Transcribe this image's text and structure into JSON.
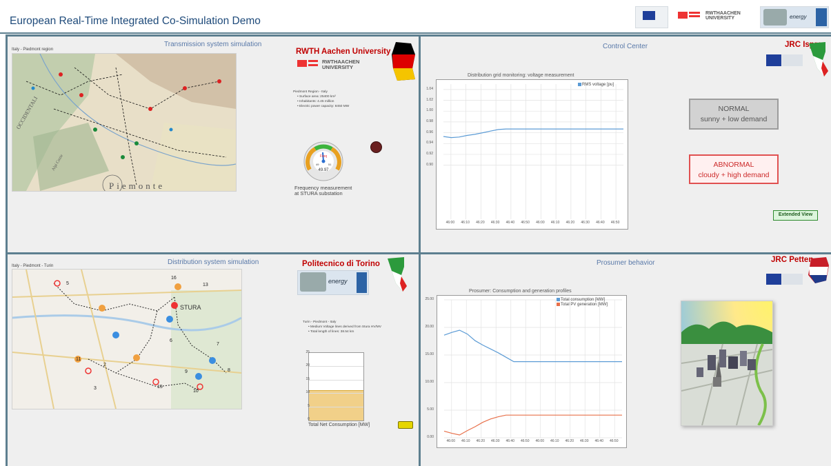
{
  "app": {
    "title": "European Real-Time Integrated Co-Simulation Demo",
    "header_logos": [
      "eu-commission-logo",
      "rwth-eonerc-logo",
      "polito-energy-logo"
    ],
    "header_logo_text": "RWTHAACHEN UNIVERSITY"
  },
  "transmission": {
    "title": "Transmission system simulation",
    "region_label": "Italy - Piedmont region",
    "institution": "RWTH Aachen University",
    "logo_text": "RWTHAACHEN UNIVERSITY",
    "info_heading": "Piedmont Region - Italy",
    "info_items": [
      "Surface area: 25400 km²",
      "Inhabitants: 4.45 million",
      "Electric power capacity: 8450 MW"
    ],
    "gauge_title": "Freq",
    "gauge_min": "49",
    "gauge_max": "51",
    "gauge_value": "49.97",
    "freq_caption_1": "Frequency measurement",
    "freq_caption_2": "at STURA substation",
    "map_words": [
      "Piemonte",
      "OCCIDENTALI",
      "Alpi Cozie"
    ]
  },
  "control": {
    "title": "Control Center",
    "institution": "JRC Ispra",
    "normal_label": "NORMAL",
    "normal_sub": "sunny + low demand",
    "abnormal_label": "ABNORMAL",
    "abnormal_sub": "cloudy + high demand",
    "extended_view": "Extended View"
  },
  "distribution": {
    "title": "Distribution system simulation",
    "region_label": "Italy - Piedmont - Turin",
    "institution": "Politecnico di Torino",
    "substation": "STURA",
    "info_heading": "Turin - Piedmont - Italy",
    "info_items": [
      "Medium Voltage lines derived from Stura HV/MV",
      "Total length of lines: 38.54 km"
    ],
    "bar_caption": "Total Net Consumption [MW]",
    "bar_ticks": [
      "25",
      "20",
      "15",
      "10",
      "5",
      "0"
    ],
    "bar_value": 11,
    "node_labels": [
      "5",
      "16",
      "13",
      "7",
      "8",
      "6",
      "9",
      "10",
      "11",
      "15",
      "3",
      "2"
    ]
  },
  "prosumer": {
    "title": "Prosumer behavior",
    "institution": "JRC Petten"
  },
  "colors": {
    "accent_blue": "#5b9bd5",
    "orange": "#e8704a",
    "inst_red": "#c00000",
    "frame": "#5d7f8f"
  },
  "chart_data": [
    {
      "type": "line",
      "title": "Distribution grid monitoring: voltage measurement",
      "x": [
        "46:00",
        "46:10",
        "46:20",
        "46:30",
        "46:40",
        "46:50",
        "46:00",
        "46:10",
        "46:20",
        "46:30",
        "46:40",
        "46:50"
      ],
      "ylim": [
        0.8,
        1.05
      ],
      "yticks": [
        "1.04",
        "1.02",
        "1.00",
        "0.98",
        "0.96",
        "0.94",
        "0.92",
        "0.90"
      ],
      "series": [
        {
          "name": "RMS voltage [pu]",
          "color": "#5b9bd5",
          "values": [
            0.953,
            0.951,
            0.952,
            0.955,
            0.957,
            0.96,
            0.963,
            0.966,
            0.967,
            0.967,
            0.967,
            0.967,
            0.967,
            0.967,
            0.967,
            0.967,
            0.967,
            0.967,
            0.967,
            0.967,
            0.967,
            0.967,
            0.967,
            0.967
          ]
        }
      ],
      "grid": true,
      "legend": "top-right"
    },
    {
      "type": "line",
      "title": "Prosumer: Consumption and generation profiles",
      "x": [
        "46:00",
        "46:10",
        "46:20",
        "46:30",
        "46:40",
        "46:50",
        "46:00",
        "46:10",
        "46:20",
        "46:30",
        "46:40",
        "46:50"
      ],
      "ylim": [
        0,
        25
      ],
      "yticks": [
        "25.00",
        "20.00",
        "15.00",
        "10.00",
        "5.00",
        "0.00"
      ],
      "series": [
        {
          "name": "Total consumption [MW]",
          "color": "#5b9bd5",
          "values": [
            18.6,
            19.1,
            19.5,
            18.8,
            17.6,
            16.8,
            16.1,
            15.4,
            14.6,
            13.8,
            13.8,
            13.8,
            13.8,
            13.8,
            13.8,
            13.8,
            13.8,
            13.8,
            13.8,
            13.8,
            13.8,
            13.8,
            13.8,
            13.8
          ]
        },
        {
          "name": "Total PV generation [MW]",
          "color": "#e8704a",
          "values": [
            1.2,
            0.8,
            0.5,
            1.3,
            2.0,
            2.8,
            3.4,
            3.8,
            4.1,
            4.1,
            4.1,
            4.1,
            4.1,
            4.1,
            4.1,
            4.1,
            4.1,
            4.1,
            4.1,
            4.1,
            4.1,
            4.1,
            4.1,
            4.1
          ]
        }
      ],
      "grid": true,
      "legend": "top-right"
    }
  ]
}
